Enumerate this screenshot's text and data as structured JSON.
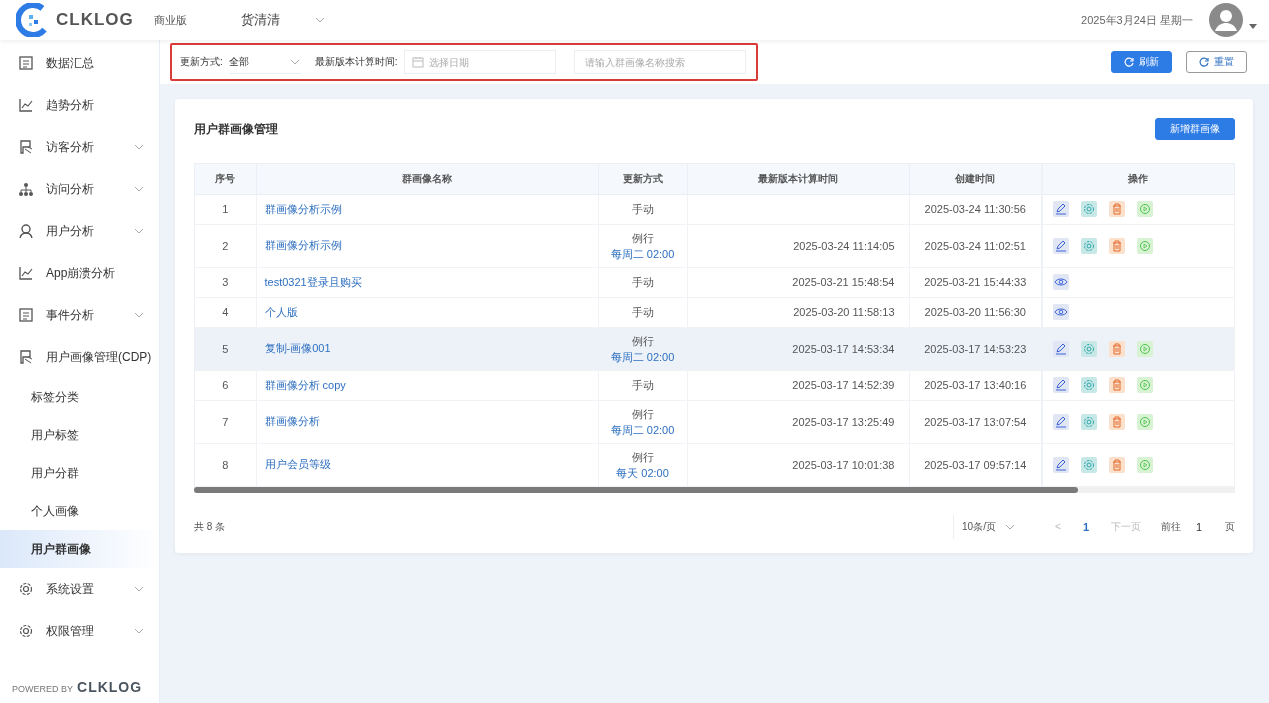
{
  "header": {
    "logo": "CLKLOG",
    "edition": "商业版",
    "project": "货清清",
    "date": "2025年3月24日 星期一"
  },
  "sidebar": {
    "items": [
      {
        "label": "数据汇总",
        "kind": "doc",
        "expandable": false
      },
      {
        "label": "趋势分析",
        "kind": "chart",
        "expandable": false
      },
      {
        "label": "访客分析",
        "kind": "visitor",
        "expandable": true,
        "expanded": false
      },
      {
        "label": "访问分析",
        "kind": "network",
        "expandable": true,
        "expanded": false
      },
      {
        "label": "用户分析",
        "kind": "user",
        "expandable": true,
        "expanded": false
      },
      {
        "label": "App崩溃分析",
        "kind": "chart",
        "expandable": false
      },
      {
        "label": "事件分析",
        "kind": "doc",
        "expandable": true,
        "expanded": false
      },
      {
        "label": "用户画像管理(CDP)",
        "kind": "visitor",
        "expandable": true,
        "expanded": true,
        "children": [
          {
            "label": "标签分类",
            "selected": false
          },
          {
            "label": "用户标签",
            "selected": false
          },
          {
            "label": "用户分群",
            "selected": false
          },
          {
            "label": "个人画像",
            "selected": false
          },
          {
            "label": "用户群画像",
            "selected": true
          }
        ]
      },
      {
        "label": "系统设置",
        "kind": "gear",
        "expandable": true,
        "expanded": false
      },
      {
        "label": "权限管理",
        "kind": "gear",
        "expandable": true,
        "expanded": false
      }
    ],
    "footer": {
      "prefix": "POWERED BY",
      "logo": "CLKLOG"
    }
  },
  "filters": {
    "highlighted": true,
    "mode_label": "更新方式:",
    "mode_value": "全部",
    "time_label": "最新版本计算时间:",
    "date_placeholder": "选择日期",
    "search_placeholder": "请输入群画像名称搜索"
  },
  "toolbar": {
    "buttons": [
      {
        "label": "刷新",
        "kind": "primary"
      },
      {
        "label": "重置",
        "kind": "default"
      }
    ]
  },
  "card": {
    "title": "用户群画像管理",
    "add_button": "新增群画像"
  },
  "table": {
    "columns": [
      "序号",
      "群画像名称",
      "更新方式",
      "最新版本计算时间",
      "创建时间",
      "操作"
    ],
    "rows": [
      {
        "index": "1",
        "name": "群画像分析示例",
        "mode": "手动",
        "computed": "",
        "created": "2025-03-24 11:30:56",
        "highlighted": false,
        "actions": [
          {
            "kind": "edit"
          },
          {
            "kind": "settings"
          },
          {
            "kind": "delete"
          },
          {
            "kind": "run"
          }
        ]
      },
      {
        "index": "2",
        "name": "群画像分析示例",
        "mode": "例行",
        "schedule": "每周二 02:00",
        "computed": "2025-03-24 11:14:05",
        "created": "2025-03-24 11:02:51",
        "highlighted": false,
        "actions": [
          {
            "kind": "edit"
          },
          {
            "kind": "settings"
          },
          {
            "kind": "delete"
          },
          {
            "kind": "run"
          }
        ]
      },
      {
        "index": "3",
        "name": "test0321登录且购买",
        "mode": "手动",
        "computed": "2025-03-21 15:48:54",
        "created": "2025-03-21 15:44:33",
        "highlighted": false,
        "actions": [
          {
            "kind": "view"
          }
        ]
      },
      {
        "index": "4",
        "name": "个人版",
        "mode": "手动",
        "computed": "2025-03-20 11:58:13",
        "created": "2025-03-20 11:56:30",
        "highlighted": false,
        "actions": [
          {
            "kind": "view"
          }
        ]
      },
      {
        "index": "5",
        "name": "复制-画像001",
        "mode": "例行",
        "schedule": "每周二 02:00",
        "computed": "2025-03-17 14:53:34",
        "created": "2025-03-17 14:53:23",
        "highlighted": true,
        "actions": [
          {
            "kind": "edit"
          },
          {
            "kind": "settings"
          },
          {
            "kind": "delete"
          },
          {
            "kind": "run"
          }
        ]
      },
      {
        "index": "6",
        "name": "群画像分析 copy",
        "mode": "手动",
        "computed": "2025-03-17 14:52:39",
        "created": "2025-03-17 13:40:16",
        "highlighted": false,
        "actions": [
          {
            "kind": "edit"
          },
          {
            "kind": "settings"
          },
          {
            "kind": "delete"
          },
          {
            "kind": "run"
          }
        ]
      },
      {
        "index": "7",
        "name": "群画像分析",
        "mode": "例行",
        "schedule": "每周二 02:00",
        "computed": "2025-03-17 13:25:49",
        "created": "2025-03-17 13:07:54",
        "highlighted": false,
        "actions": [
          {
            "kind": "edit"
          },
          {
            "kind": "settings"
          },
          {
            "kind": "delete"
          },
          {
            "kind": "run"
          }
        ]
      },
      {
        "index": "8",
        "name": "用户会员等级",
        "mode": "例行",
        "schedule": "每天 02:00",
        "computed": "2025-03-17 10:01:38",
        "created": "2025-03-17 09:57:14",
        "highlighted": false,
        "actions": [
          {
            "kind": "edit"
          },
          {
            "kind": "settings"
          },
          {
            "kind": "delete"
          },
          {
            "kind": "run"
          }
        ]
      }
    ]
  },
  "pagination": {
    "total": "共 8 条",
    "page_size": "10条/页",
    "prev": "<",
    "pages": [
      {
        "label": "1",
        "selected": true
      }
    ],
    "next": "下一页",
    "next_disabled": true,
    "goto_label": "前往",
    "goto_value": "1",
    "goto_suffix": "页"
  }
}
